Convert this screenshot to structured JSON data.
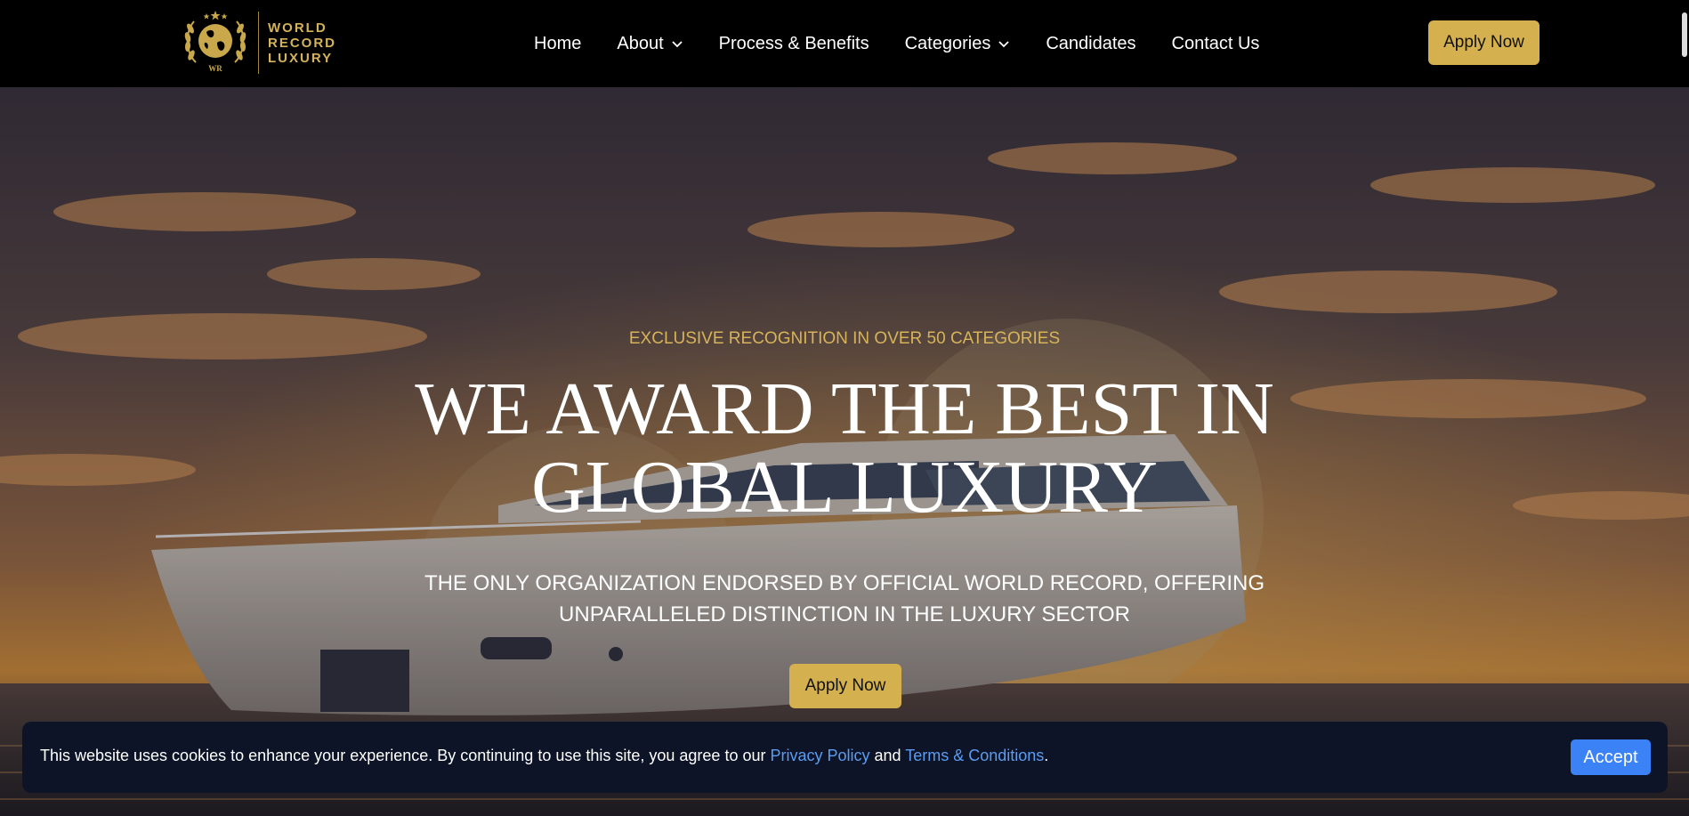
{
  "brand": {
    "name_lines": [
      "WORLD",
      "RECORD",
      "LUXURY"
    ],
    "emblem_text": "WR",
    "color": "#d4b35a"
  },
  "nav": {
    "items": [
      {
        "label": "Home",
        "has_dropdown": false
      },
      {
        "label": "About",
        "has_dropdown": true
      },
      {
        "label": "Process & Benefits",
        "has_dropdown": false
      },
      {
        "label": "Categories",
        "has_dropdown": true
      },
      {
        "label": "Candidates",
        "has_dropdown": false
      },
      {
        "label": "Contact Us",
        "has_dropdown": false
      }
    ],
    "apply_label": "Apply Now"
  },
  "hero": {
    "eyebrow": "EXCLUSIVE RECOGNITION IN OVER 50 CATEGORIES",
    "headline_line1": "WE AWARD THE BEST IN",
    "headline_line2": "GLOBAL LUXURY",
    "subheadline": "THE ONLY ORGANIZATION ENDORSED BY OFFICIAL WORLD RECORD, OFFERING UNPARALLELED DISTINCTION IN THE LUXURY SECTOR",
    "apply_label": "Apply Now",
    "accent_color": "#d4b04e"
  },
  "cookie_banner": {
    "text_before": "This website uses cookies to enhance your experience. By continuing to use this site, you agree to our ",
    "privacy_link": "Privacy Policy",
    "text_middle": " and ",
    "terms_link": "Terms & Conditions",
    "text_after": ".",
    "accept_label": "Accept",
    "link_color": "#5b9cf0",
    "accept_color": "#3b82f6"
  }
}
